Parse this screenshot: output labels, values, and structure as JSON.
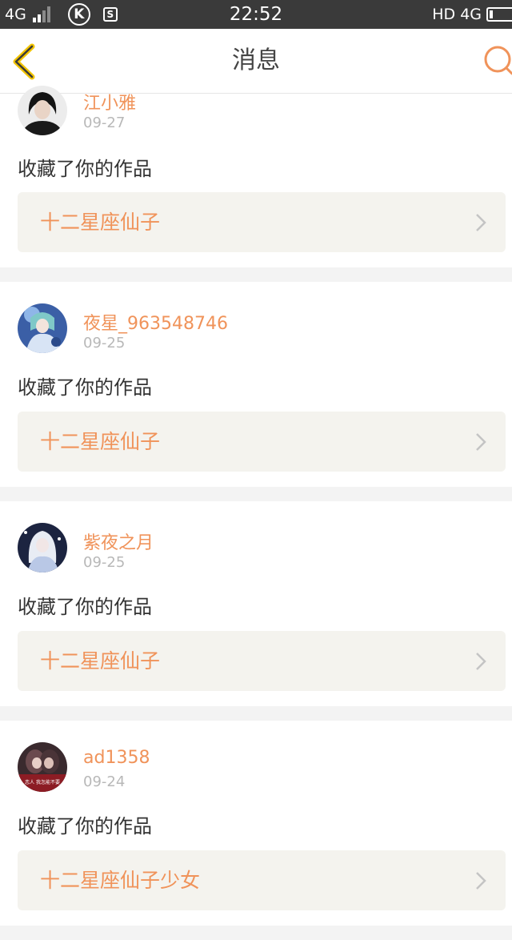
{
  "status_bar": {
    "network": "4G",
    "time": "22:52",
    "hd": "HD",
    "network_right": "4G",
    "app_icon_k": "K",
    "app_icon_s": "S"
  },
  "header": {
    "title": "消息"
  },
  "messages": [
    {
      "username": "江小雅",
      "date": "09-27",
      "action": "收藏了你的作品",
      "work_title": "十二星座仙子"
    },
    {
      "username": "夜星_963548746",
      "date": "09-25",
      "action": "收藏了你的作品",
      "work_title": "十二星座仙子"
    },
    {
      "username": "紫夜之月",
      "date": "09-25",
      "action": "收藏了你的作品",
      "work_title": "十二星座仙子"
    },
    {
      "username": "ad1358",
      "date": "09-24",
      "action": "收藏了你的作品",
      "work_title": "十二星座仙子少女",
      "avatar_caption": "恋人  我怎能不要"
    }
  ],
  "colors": {
    "accent": "#f0935a",
    "back_icon": "#f2c400",
    "status_bar_bg": "#3a3a3a",
    "card_inner_bg": "#f4f3ee"
  },
  "icons": {
    "back": "chevron-left-icon",
    "search": "search-icon",
    "row_arrow": "chevron-right-icon"
  }
}
